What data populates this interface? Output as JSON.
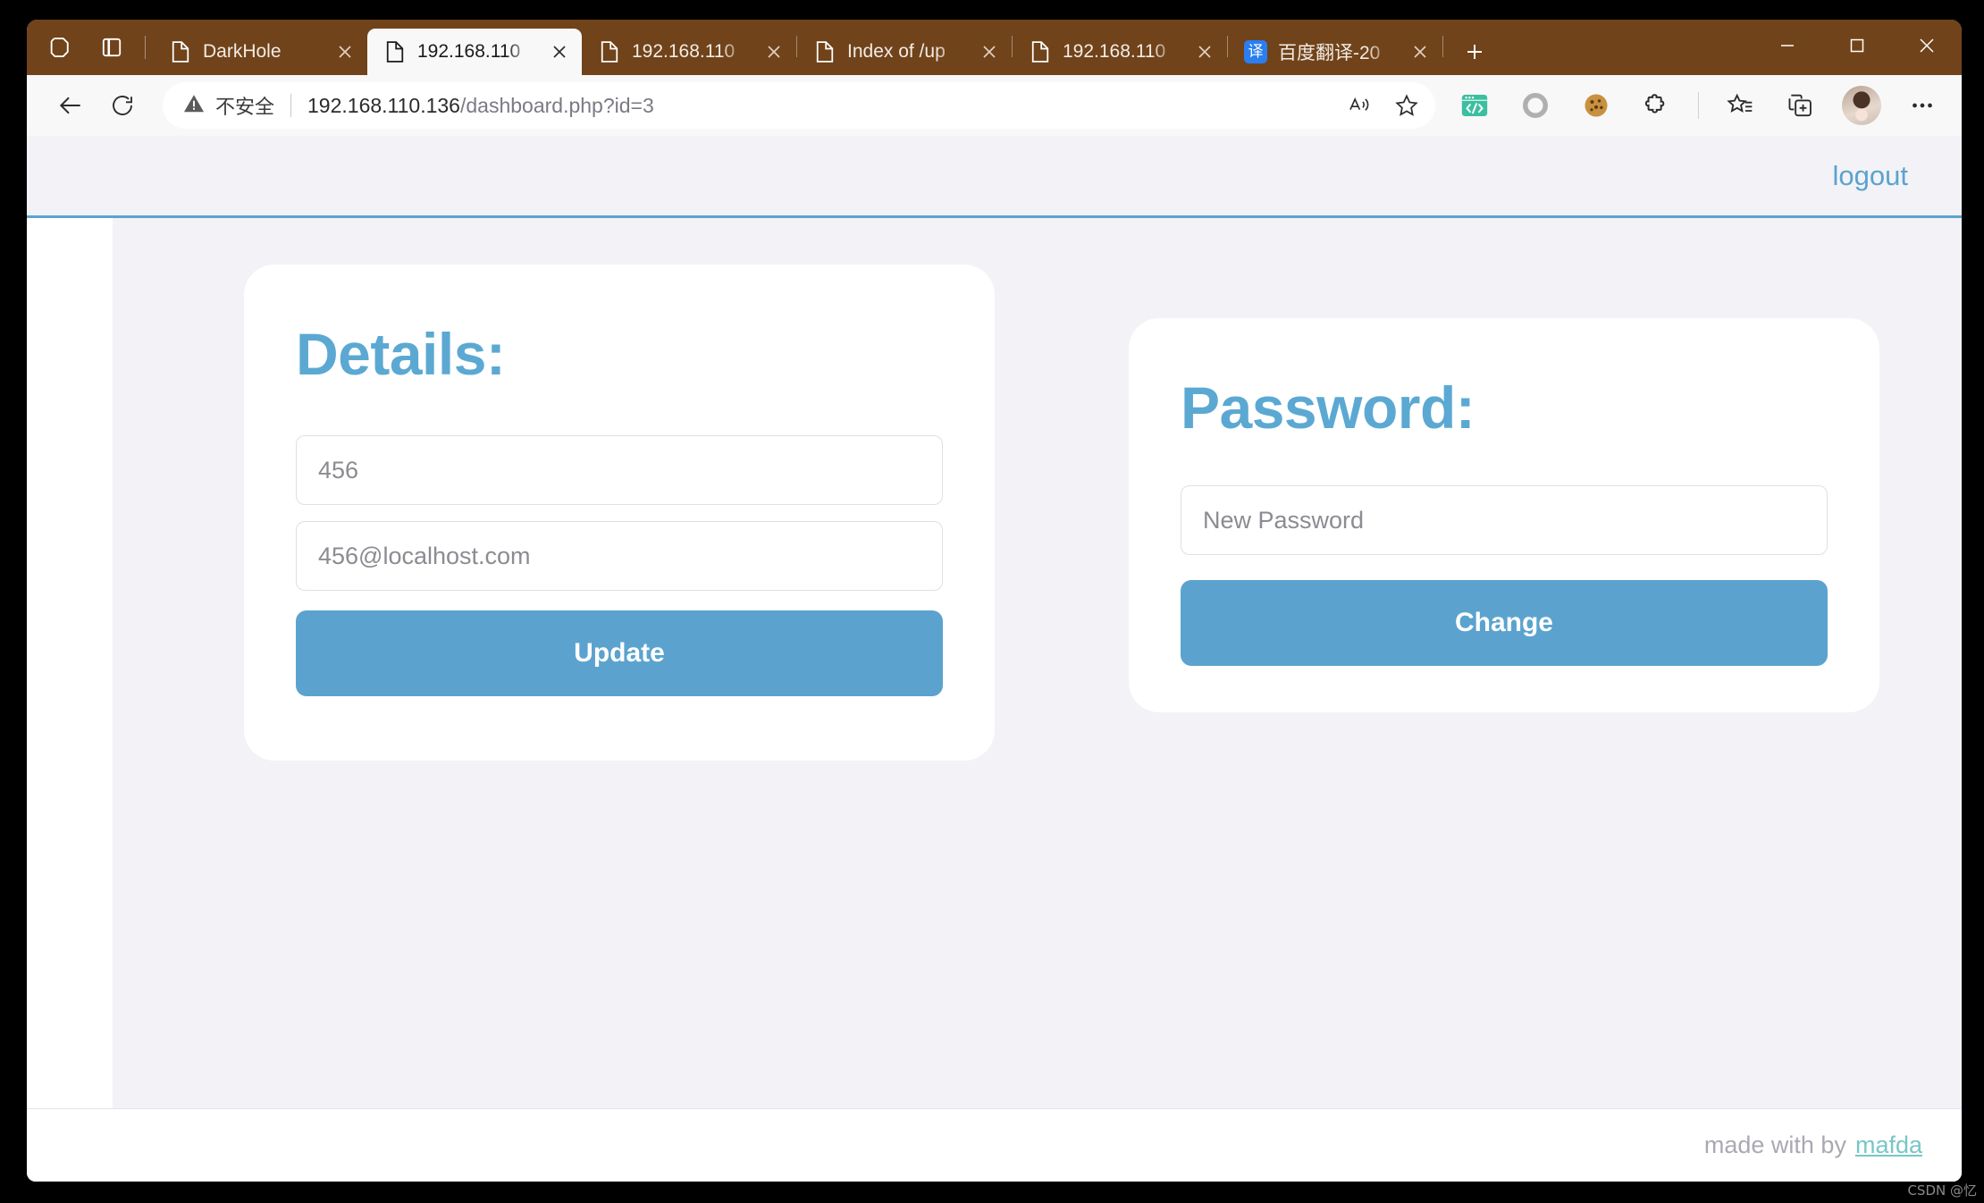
{
  "browser": {
    "tab_strip": {
      "workspaces_icon": "workspaces-icon",
      "tab_list_icon": "tab-list-icon",
      "new_tab_label": "+",
      "tabs": [
        {
          "title": "DarkHole",
          "favicon": "page-icon",
          "active": false
        },
        {
          "title": "192.168.110",
          "favicon": "page-icon",
          "active": true
        },
        {
          "title": "192.168.110",
          "favicon": "page-icon",
          "active": false
        },
        {
          "title": "Index of /up",
          "favicon": "page-icon",
          "active": false
        },
        {
          "title": "192.168.110",
          "favicon": "page-icon",
          "active": false
        },
        {
          "title": "百度翻译-20",
          "favicon": "translate-badge-icon",
          "favicon_text": "译",
          "active": false
        }
      ]
    },
    "window_controls": {
      "minimize": "minimize-icon",
      "maximize": "maximize-icon",
      "close": "close-icon"
    },
    "toolbar": {
      "back_icon": "back-arrow-icon",
      "reload_icon": "reload-icon",
      "security_icon": "warning-triangle-icon",
      "security_text": "不安全",
      "url_host": "192.168.110.136",
      "url_path": "/dashboard.php?id=3",
      "read_aloud_icon": "read-aloud-icon",
      "favorite_icon": "star-outline-icon",
      "extensions": [
        {
          "name": "code-extension-icon",
          "color": "#3cbfa0"
        },
        {
          "name": "circle-extension-icon",
          "color": "#b0b0b0"
        },
        {
          "name": "cookie-extension-icon",
          "color": "#c8913f"
        },
        {
          "name": "puzzle-extensions-icon",
          "color": "#2b2b2b"
        }
      ],
      "collections_icon": "favorites-list-icon",
      "add_collection_icon": "add-to-collections-icon",
      "profile_icon": "profile-avatar",
      "settings_icon": "more-options-icon"
    }
  },
  "page": {
    "header": {
      "logout_label": "logout"
    },
    "details": {
      "title": "Details:",
      "username_value": "456",
      "username_placeholder": "456",
      "email_value": "456@localhost.com",
      "email_placeholder": "456@localhost.com",
      "submit_label": "Update"
    },
    "password": {
      "title": "Password:",
      "new_password_value": "New Password",
      "new_password_placeholder": "New Password",
      "submit_label": "Change"
    },
    "footer": {
      "text": "made with by",
      "author": "mafda"
    },
    "colors": {
      "accent": "#5ba3ce",
      "title": "#5ba9d2",
      "author": "#79c6c6",
      "page_bg": "#f2f2f7",
      "titlebar": "#70431a"
    }
  },
  "watermark": {
    "text": "CSDN @忆"
  }
}
